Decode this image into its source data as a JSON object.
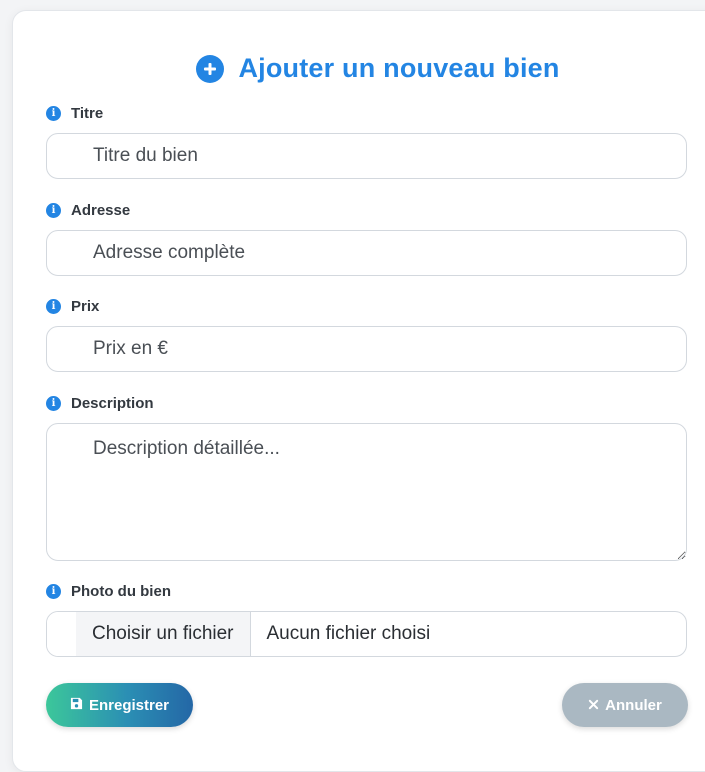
{
  "form": {
    "title": "Ajouter un nouveau bien",
    "fields": {
      "titre": {
        "label": "Titre",
        "placeholder": "Titre du bien",
        "value": ""
      },
      "adresse": {
        "label": "Adresse",
        "placeholder": "Adresse complète",
        "value": ""
      },
      "prix": {
        "label": "Prix",
        "placeholder": "Prix en €",
        "value": ""
      },
      "description": {
        "label": "Description",
        "placeholder": "Description détaillée...",
        "value": ""
      },
      "photo": {
        "label": "Photo du bien",
        "button_label": "Choisir un fichier",
        "status": "Aucun fichier choisi"
      }
    },
    "buttons": {
      "save_label": "Enregistrer",
      "cancel_label": "Annuler"
    }
  },
  "icons": {
    "title_icon": "plus-circle-icon",
    "label_icon": "info-circle-icon",
    "save_icon": "floppy-disk-icon",
    "cancel_icon": "x-icon"
  },
  "colors": {
    "accent": "#2385e3",
    "save_gradient_start": "#3cc79a",
    "save_gradient_end": "#2467a6",
    "cancel_bg": "#aab8c2"
  }
}
